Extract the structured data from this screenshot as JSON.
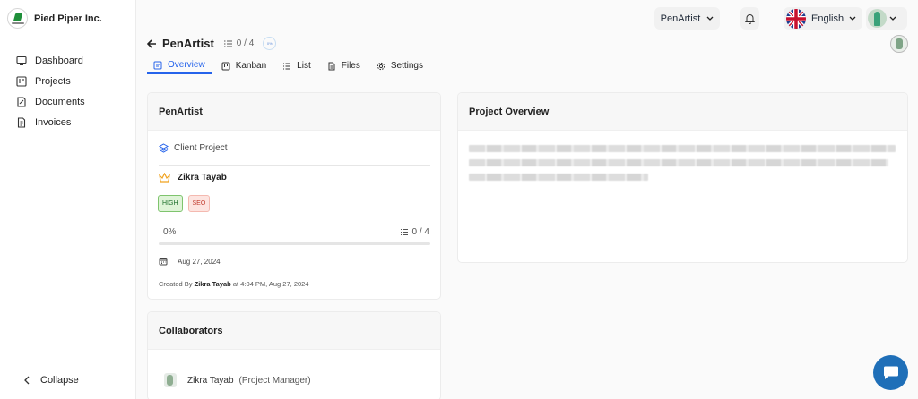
{
  "brand": {
    "name": "Pied Piper Inc."
  },
  "sidebar": {
    "items": [
      {
        "label": "Dashboard",
        "icon": "dashboard-icon"
      },
      {
        "label": "Projects",
        "icon": "projects-icon"
      },
      {
        "label": "Documents",
        "icon": "documents-icon"
      },
      {
        "label": "Invoices",
        "icon": "invoices-icon"
      }
    ],
    "collapse_label": "Collapse"
  },
  "topbar": {
    "project_selector": "PenArtist",
    "language": "English"
  },
  "project": {
    "title": "PenArtist",
    "task_count": "0 / 4",
    "progress_badge": "0%"
  },
  "tabs": [
    {
      "label": "Overview",
      "active": true,
      "icon": "overview-icon"
    },
    {
      "label": "Kanban",
      "icon": "kanban-icon"
    },
    {
      "label": "List",
      "icon": "list-icon"
    },
    {
      "label": "Files",
      "icon": "files-icon"
    },
    {
      "label": "Settings",
      "icon": "settings-icon"
    }
  ],
  "info_card": {
    "title": "PenArtist",
    "project_type": "Client Project",
    "owner": "Zikra Tayab",
    "badges": {
      "priority": "HIGH",
      "tag": "SEO"
    },
    "progress_label": "0%",
    "progress_value": 0,
    "tasks": "0 / 4",
    "date": "Aug 27, 2024",
    "created_prefix": "Created By",
    "created_by": "Zikra Tayab",
    "created_suffix": "at 4:04 PM, Aug 27, 2024"
  },
  "overview_card": {
    "title": "Project Overview"
  },
  "collaborators": {
    "title": "Collaborators",
    "members": [
      {
        "name": "Zikra Tayab",
        "role": "(Project Manager)"
      }
    ]
  },
  "colors": {
    "accent": "#2563eb",
    "chat": "#1f6fb8",
    "high": "#1d6f2c",
    "seo": "#c0392b"
  }
}
